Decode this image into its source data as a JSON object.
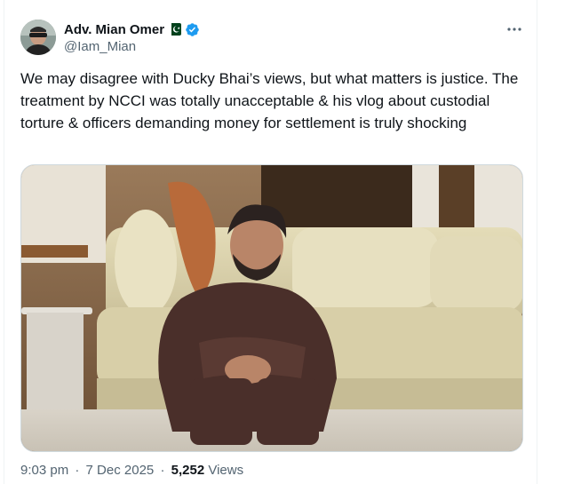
{
  "tweet": {
    "author": {
      "display_name": "Adv. Mian Omer",
      "handle": "@Iam_Mian",
      "flag_icon": "pakistan-flag-icon",
      "verified_icon": "verified-badge-icon"
    },
    "text": "We may disagree with Ducky Bhai’s views, but what matters is justice. The treatment by NCCI was totally unacceptable & his vlog about custodial torture & officers demanding money for settlement is truly shocking",
    "media": {
      "kind": "photo",
      "subject": "man sitting on floor in front of a beige sofa"
    },
    "timestamp": {
      "time": "9:03 pm",
      "separator": "·",
      "date": "7 Dec 2025"
    },
    "views": {
      "count": "5,252",
      "label": "Views"
    }
  },
  "colors": {
    "text_primary": "#0f1419",
    "text_secondary": "#536471",
    "verified_blue": "#1d9bf0",
    "border": "#cfd9de"
  }
}
